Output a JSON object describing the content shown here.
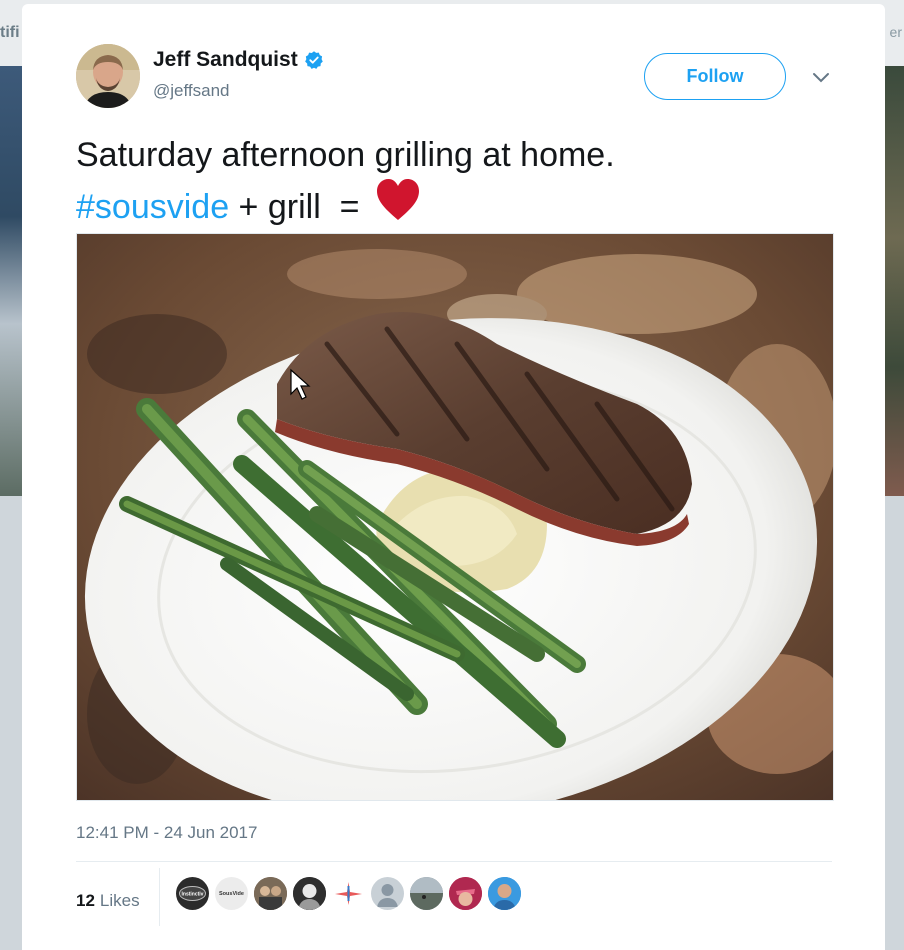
{
  "background": {
    "left_text": "tifi",
    "right_text": "er"
  },
  "tweet": {
    "author_name": "Jeff Sandquist",
    "handle": "@jeffsand",
    "verified": true,
    "follow_label": "Follow",
    "text_line1": "Saturday afternoon grilling at home.",
    "hashtag": "#sousvide",
    "text_line2_rest": " + grill  = ",
    "heart_icon": "red-heart-emoji",
    "timestamp": "12:41 PM - 24 Jun 2017",
    "likes_count": "12",
    "likes_label": "Likes",
    "likers": [
      {
        "name": "liker-1",
        "label": "Instinctiv",
        "color": "#2b2b2b"
      },
      {
        "name": "liker-2",
        "label": "SousVide",
        "color": "#e8e8e8"
      },
      {
        "name": "liker-3",
        "label": "",
        "color": "#6b5a4a"
      },
      {
        "name": "liker-4",
        "label": "",
        "color": "#3a3a3a"
      },
      {
        "name": "liker-5",
        "label": "",
        "color": "#ffffff"
      },
      {
        "name": "liker-6",
        "label": "",
        "color": "#b8c2cc"
      },
      {
        "name": "liker-7",
        "label": "",
        "color": "#7d8a8f"
      },
      {
        "name": "liker-8",
        "label": "",
        "color": "#c23a5a"
      },
      {
        "name": "liker-9",
        "label": "",
        "color": "#2f8fd8"
      }
    ]
  },
  "colors": {
    "accent": "#1da1f2",
    "text": "#14171a",
    "secondary": "#657786",
    "heart": "#e0245e"
  }
}
